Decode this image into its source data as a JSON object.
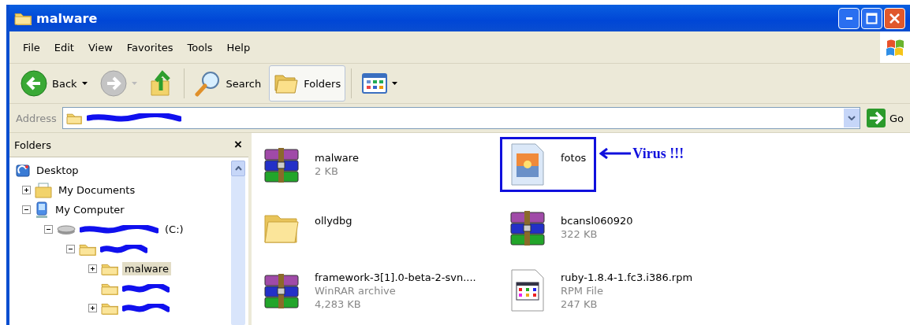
{
  "window": {
    "title": "malware"
  },
  "menu": [
    {
      "label": "File"
    },
    {
      "label": "Edit"
    },
    {
      "label": "View"
    },
    {
      "label": "Favorites"
    },
    {
      "label": "Tools"
    },
    {
      "label": "Help"
    }
  ],
  "toolbar": [
    {
      "kind": "back",
      "label": "Back",
      "dropdown": true,
      "disabled": false,
      "pressed": false
    },
    {
      "kind": "forward",
      "dropdown": true,
      "disabled": true,
      "pressed": false
    },
    {
      "kind": "up",
      "dropdown": false,
      "disabled": false,
      "pressed": false
    },
    {
      "kind": "search",
      "label": "Search",
      "dropdown": false,
      "disabled": false,
      "pressed": false
    },
    {
      "kind": "folders",
      "label": "Folders",
      "dropdown": false,
      "disabled": false,
      "pressed": true
    },
    {
      "kind": "views",
      "dropdown": true,
      "disabled": false,
      "pressed": false
    }
  ],
  "address": {
    "label": "Address",
    "redacted": true,
    "go": "Go"
  },
  "folders": {
    "title": "Folders",
    "close": "×",
    "tree": [
      {
        "kind": "desktop",
        "label": "Desktop",
        "toggle": false,
        "selected": false,
        "children": [
          {
            "kind": "documents",
            "label": "My Documents",
            "toggle": true,
            "expanded": false,
            "selected": false
          },
          {
            "kind": "computer",
            "label": "My Computer",
            "toggle": true,
            "expanded": true,
            "selected": false,
            "children": [
              {
                "kind": "drive",
                "label": "(C:)",
                "redacted": true,
                "toggle": true,
                "expanded": true,
                "selected": false,
                "children": [
                  {
                    "kind": "folder",
                    "redacted": true,
                    "toggle": true,
                    "expanded": true,
                    "selected": false,
                    "children": [
                      {
                        "kind": "folder",
                        "label": "malware",
                        "toggle": true,
                        "expanded": false,
                        "selected": true
                      },
                      {
                        "kind": "folder",
                        "redacted": true,
                        "toggle": false,
                        "selected": false
                      },
                      {
                        "kind": "folder",
                        "redacted": true,
                        "toggle": true,
                        "expanded": false,
                        "selected": false
                      }
                    ]
                  }
                ]
              }
            ]
          }
        ]
      }
    ]
  },
  "files": [
    {
      "kind": "archive",
      "name": "malware",
      "details": [
        "2 KB"
      ]
    },
    {
      "kind": "image",
      "name": "fotos",
      "callout": "Virus !!!"
    },
    {
      "kind": "folder",
      "name": "ollydbg"
    },
    {
      "kind": "archive",
      "name": "bcansl060920",
      "details": [
        "322 KB"
      ]
    },
    {
      "kind": "archive",
      "name": "framework-3[1].0-beta-2-svn....",
      "details": [
        "WinRAR archive",
        "4,283 KB"
      ]
    },
    {
      "kind": "document",
      "name": "ruby-1.8.4-1.fc3.i386.rpm",
      "details": [
        "RPM File",
        "247 KB"
      ]
    }
  ]
}
